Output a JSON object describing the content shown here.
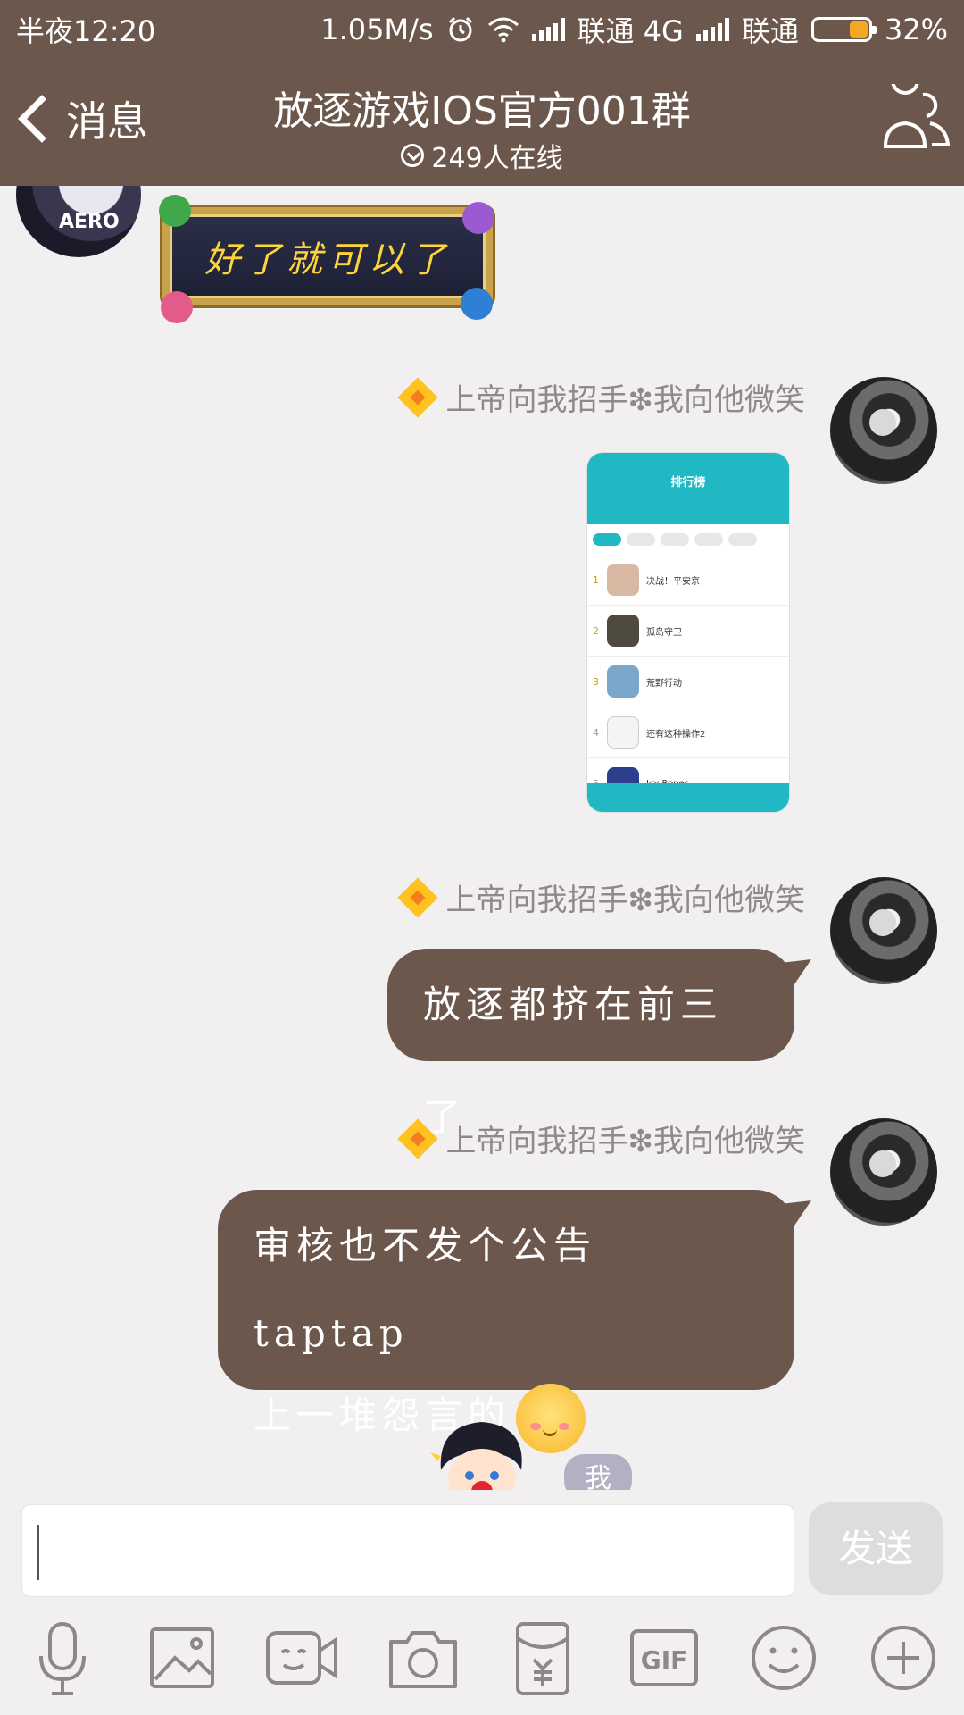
{
  "status_bar": {
    "time": "半夜12:20",
    "speed": "1.05M/s",
    "carrier1": "联通 4G",
    "carrier2": "联通",
    "battery": "32%"
  },
  "nav": {
    "back_label": "消息",
    "title": "放逐游戏IOS官方001群",
    "online": "249人在线"
  },
  "messages": {
    "sticker_text": "好了就可以了",
    "sender_name": "上帝向我招手❇我向他微笑",
    "bubble1": "放逐都挤在前三了",
    "bubble2_line1": "审核也不发个公告  taptap",
    "bubble2_line2": "上一堆怨言的",
    "me_tag": "我"
  },
  "screenshot_thumb": {
    "title": "排行榜",
    "rows": [
      "决战！平安京",
      "孤岛守卫",
      "荒野行动",
      "还有这种操作2",
      "Icy Ropes"
    ]
  },
  "input": {
    "placeholder": "",
    "send_label": "发送"
  },
  "toolbar": [
    "mic-icon",
    "image-icon",
    "video-icon",
    "camera-icon",
    "red-packet-icon",
    "gif-icon",
    "emoji-icon",
    "plus-icon"
  ],
  "colors": {
    "header": "#6b574c",
    "bubble": "#6b574c",
    "background": "#f1efef",
    "accent_teal": "#1fb8c3"
  }
}
